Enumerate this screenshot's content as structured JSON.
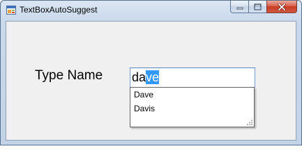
{
  "window": {
    "title": "TextBoxAutoSuggest",
    "icon": "winforms-app-icon",
    "controls": {
      "minimize": "minimize-icon",
      "maximize": "maximize-icon",
      "close": "close-icon"
    }
  },
  "form": {
    "label": "Type Name",
    "textbox": {
      "typed": "da",
      "suggested_completion": "ve"
    },
    "suggestions": [
      "Dave",
      "Davis"
    ]
  },
  "colors": {
    "selection": "#3399ff",
    "client_background": "#f0f0f0",
    "close_button": "#c63b22"
  }
}
